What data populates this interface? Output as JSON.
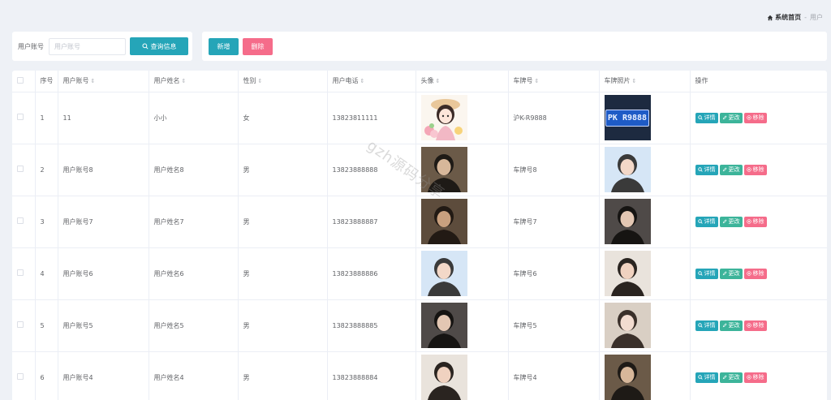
{
  "breadcrumb": {
    "home": "系统首页",
    "separator": "-",
    "current": "用户"
  },
  "search": {
    "label": "用户账号",
    "placeholder": "用户账号",
    "button": "查询信息"
  },
  "actions": {
    "add": "新增",
    "delete": "删除"
  },
  "colors": {
    "primary": "#25a5b8",
    "edit": "#3cb49a",
    "danger": "#f56c8a"
  },
  "table": {
    "headers": {
      "index": "序号",
      "account": "用户账号",
      "name": "用户姓名",
      "gender": "性别",
      "phone": "用户电话",
      "avatar": "头像",
      "plate": "车牌号",
      "plate_photo": "车牌照片",
      "ops": "操作"
    },
    "op_labels": {
      "detail": "详情",
      "edit": "更改",
      "remove": "移除"
    },
    "rows": [
      {
        "index": "1",
        "account": "11",
        "name": "小小",
        "gender": "女",
        "phone": "13823811111",
        "plate": "沪K-R9888",
        "plate_photo_text": "PK R9888",
        "avatar_icon": "girl-illustration-avatar",
        "photo_icon": "license-plate-photo"
      },
      {
        "index": "2",
        "account": "用户账号8",
        "name": "用户姓名8",
        "gender": "男",
        "phone": "13823888888",
        "plate": "车牌号8",
        "avatar_icon": "portrait-photo",
        "photo_icon": "portrait-photo"
      },
      {
        "index": "3",
        "account": "用户账号7",
        "name": "用户姓名7",
        "gender": "男",
        "phone": "13823888887",
        "plate": "车牌号7",
        "avatar_icon": "portrait-photo",
        "photo_icon": "portrait-photo"
      },
      {
        "index": "4",
        "account": "用户账号6",
        "name": "用户姓名6",
        "gender": "男",
        "phone": "13823888886",
        "plate": "车牌号6",
        "avatar_icon": "portrait-photo",
        "photo_icon": "portrait-photo"
      },
      {
        "index": "5",
        "account": "用户账号5",
        "name": "用户姓名5",
        "gender": "男",
        "phone": "13823888885",
        "plate": "车牌号5",
        "avatar_icon": "portrait-photo",
        "photo_icon": "portrait-photo"
      },
      {
        "index": "6",
        "account": "用户账号4",
        "name": "用户姓名4",
        "gender": "男",
        "phone": "13823888884",
        "plate": "车牌号4",
        "avatar_icon": "portrait-photo",
        "photo_icon": "portrait-photo"
      }
    ]
  },
  "watermark": "gzh源码分享"
}
